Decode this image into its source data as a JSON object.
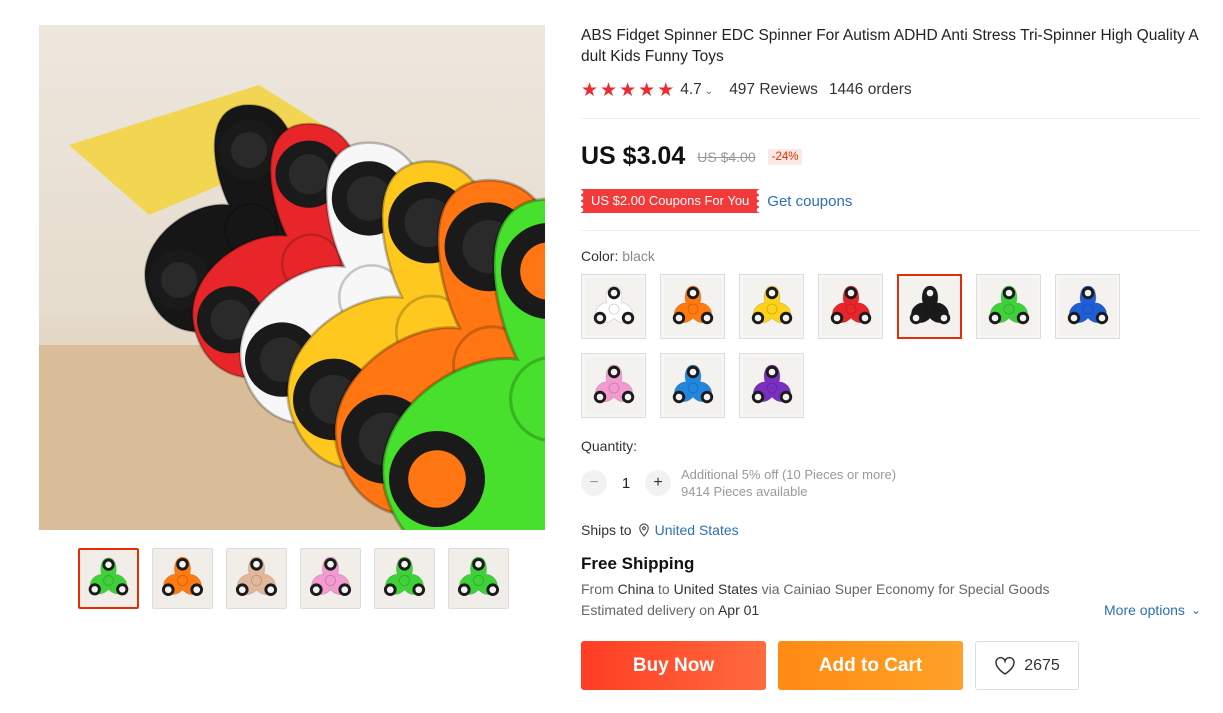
{
  "product": {
    "title": "ABS Fidget Spinner EDC Spinner For Autism ADHD Anti Stress Tri-Spinner High Quality Adult Kids Funny Toys",
    "rating": "4.7",
    "rating_stars": 5,
    "reviews": "497 Reviews",
    "orders": "1446 orders"
  },
  "price": {
    "current": "US $3.04",
    "original": "US $4.00",
    "discount": "-24%"
  },
  "coupon": {
    "badge": "US $2.00 Coupons For You",
    "link": "Get coupons"
  },
  "color": {
    "label": "Color:",
    "selected": "black",
    "swatch_colors": [
      "#ffffff",
      "#ff7a10",
      "#ffd21a",
      "#e8262a",
      "#1a1a1a",
      "#3fd13a",
      "#1f5fd6",
      "#f39ad0",
      "#2286dd",
      "#7a2fc0"
    ],
    "selected_index": 4
  },
  "quantity": {
    "label": "Quantity:",
    "value": "1",
    "note_discount": "Additional 5% off (10 Pieces or more)",
    "note_available": "9414 Pieces available"
  },
  "shipping": {
    "ships_to_label": "Ships to",
    "ships_to_country": "United States",
    "title": "Free Shipping",
    "from_label": "From",
    "from_country": "China",
    "to_label": "to",
    "to_country": "United States",
    "via_text": "via Cainiao Super Economy for Special Goods",
    "delivery_label": "Estimated delivery on",
    "delivery_date": "Apr 01",
    "more_options": "More options"
  },
  "actions": {
    "buy_now": "Buy Now",
    "add_to_cart": "Add to Cart",
    "wishlist_count": "2675"
  },
  "gallery": {
    "thumb_colors": [
      "#3fd13a",
      "#ff7a10",
      "#e3b89a",
      "#f39ad0",
      "#3fd13a",
      "#3fd13a"
    ],
    "active_index": 0
  }
}
